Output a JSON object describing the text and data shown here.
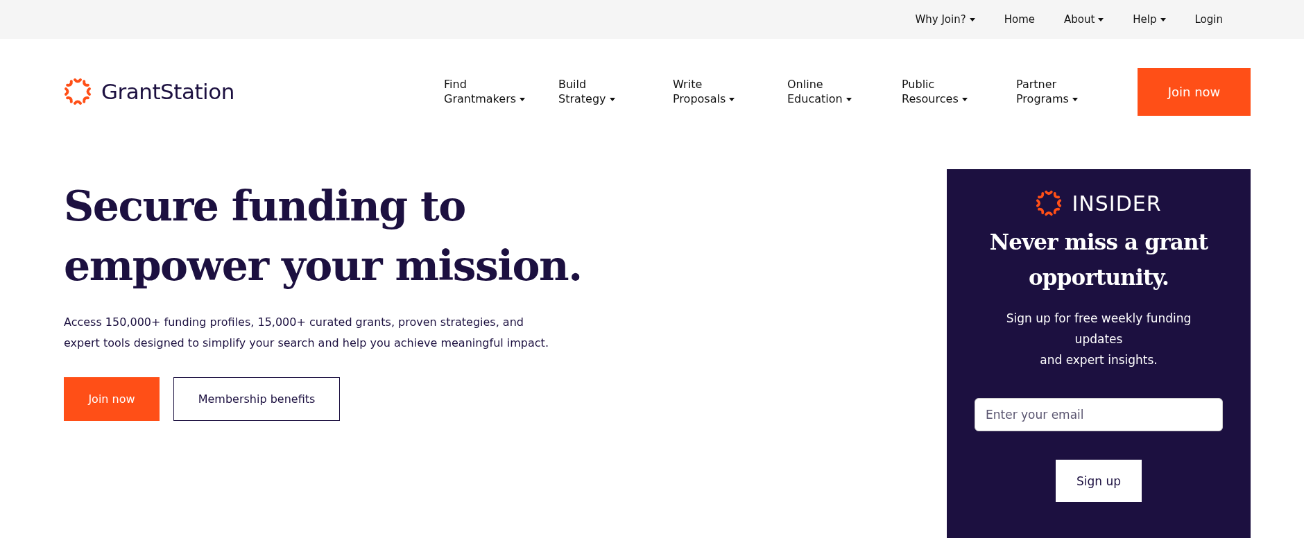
{
  "top_bar": {
    "links": [
      {
        "label": "Why Join?",
        "dropdown": true
      },
      {
        "label": "Home",
        "dropdown": false
      },
      {
        "label": "About",
        "dropdown": true
      },
      {
        "label": "Help",
        "dropdown": true
      },
      {
        "label": "Login",
        "dropdown": false
      }
    ]
  },
  "header": {
    "logo_text": "GrantStation",
    "nav": [
      {
        "label": "Find Grantmakers",
        "dropdown": true
      },
      {
        "label": "Build Strategy",
        "dropdown": true
      },
      {
        "label": "Write Proposals",
        "dropdown": true
      },
      {
        "label": "Online Education",
        "dropdown": true
      },
      {
        "label": "Public Resources",
        "dropdown": true
      },
      {
        "label": "Partner Programs",
        "dropdown": true
      }
    ],
    "cta": "Join now"
  },
  "hero": {
    "title": "Secure funding to empower your mission.",
    "text": "Access 150,000+ funding profiles, 15,000+ curated grants, proven strategies, and expert tools designed to simplify your search and help you achieve meaningful impact.",
    "buttons": [
      {
        "label": "Join now",
        "kind": "primary"
      },
      {
        "label": "Membership benefits",
        "kind": "outline"
      }
    ]
  },
  "insider": {
    "brand": "INSIDER",
    "title": "Never miss a grant opportunity.",
    "text_lines": [
      "Sign up for free weekly funding updates",
      "and expert insights."
    ],
    "email_placeholder": "Enter your email",
    "button": "Sign up"
  }
}
